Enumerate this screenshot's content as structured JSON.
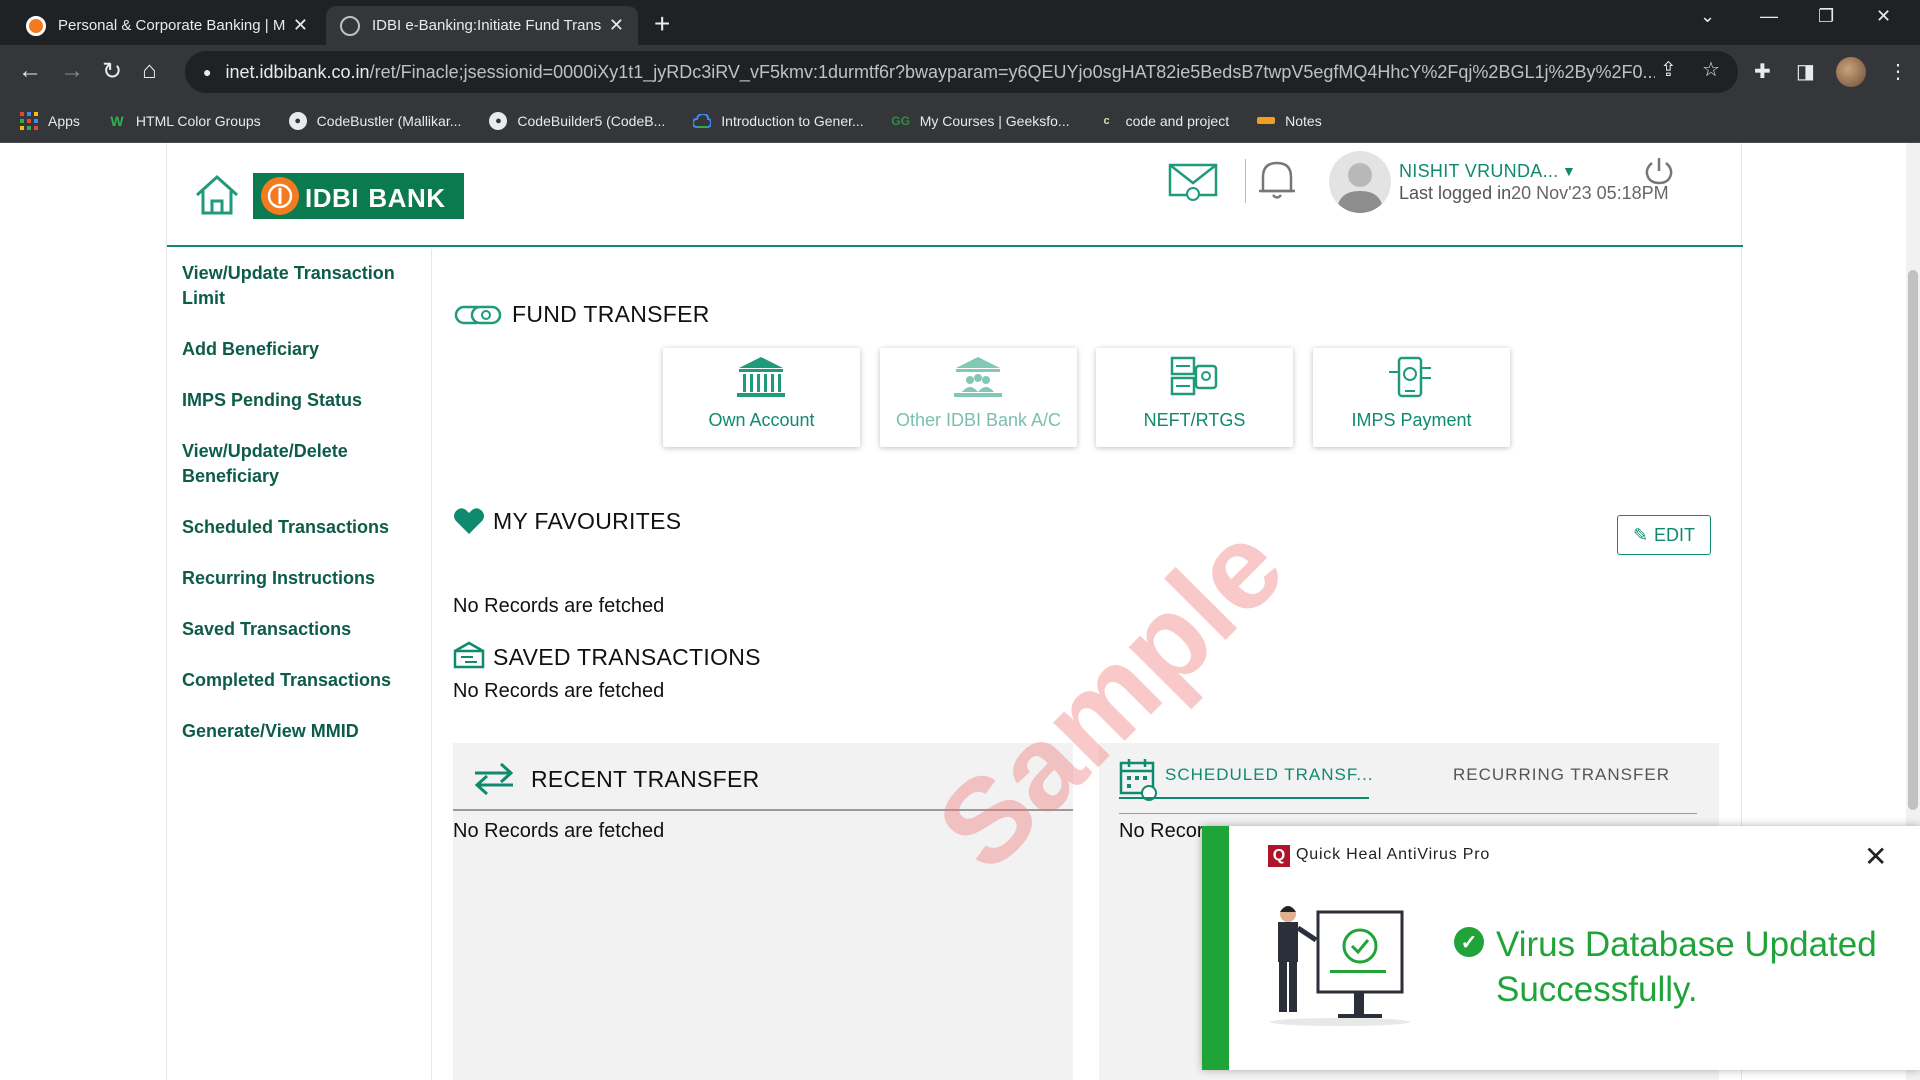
{
  "browser": {
    "tabs": [
      {
        "title": "Personal & Corporate Banking | MS",
        "active": false
      },
      {
        "title": "IDBI e-Banking:Initiate Fund Transfe",
        "active": true
      }
    ],
    "url_host": "inet.idbibank.co.in",
    "url_path": "/ret/Finacle;jsessionid=0000iXy1t1_jyRDc3iRV_vF5kmv:1durmtf6r?bwayparam=y6QEUYjo0sgHAT82ie5BedsB7twpV5egfMQ4HhcY%2Fqj%2BGL1j%2By%2F0...",
    "bookmarks": [
      {
        "label": "Apps",
        "icon": "apps-grid-icon"
      },
      {
        "label": "HTML Color Groups",
        "icon": "w-icon"
      },
      {
        "label": "CodeBustler (Mallikar...",
        "icon": "github-icon"
      },
      {
        "label": "CodeBuilder5 (CodeB...",
        "icon": "github-icon"
      },
      {
        "label": "Introduction to Gener...",
        "icon": "google-cloud-icon"
      },
      {
        "label": "My Courses | Geeksfo...",
        "icon": "geeksforgeeks-icon"
      },
      {
        "label": "code and project",
        "icon": "c-icon"
      },
      {
        "label": "Notes",
        "icon": "notes-icon"
      }
    ]
  },
  "header": {
    "logo_main": "IDBI",
    "logo_sub": "BANK",
    "user_name": "NISHIT VRUNDA...",
    "last_logged_label": "Last logged in",
    "last_logged_value": "20 Nov'23 05:18PM"
  },
  "sidebar": {
    "items": [
      "View/Update Transaction Limit",
      "Add Beneficiary",
      "IMPS Pending Status",
      "View/Update/Delete Beneficiary",
      "Scheduled Transactions",
      "Recurring Instructions",
      "Saved Transactions",
      "Completed Transactions",
      "Generate/View MMID"
    ]
  },
  "fund_transfer": {
    "title": "FUND TRANSFER",
    "options": [
      "Own Account",
      "Other IDBI Bank A/C",
      "NEFT/RTGS",
      "IMPS Payment"
    ]
  },
  "favourites": {
    "title": "MY FAVOURITES",
    "edit_label": "EDIT",
    "empty_text": "No Records are fetched"
  },
  "saved": {
    "title": "SAVED TRANSACTIONS",
    "empty_text": "No Records are fetched"
  },
  "recent": {
    "title": "RECENT TRANSFER",
    "empty_text": "No Records are fetched"
  },
  "scheduled_panel": {
    "tab1": "SCHEDULED TRANSF...",
    "tab2": "RECURRING TRANSFER",
    "empty_text_partial": "No Recor"
  },
  "watermark": "Sample",
  "toast": {
    "app_name": "Quick Heal AntiVirus Pro",
    "logo_letter": "Q",
    "message": "Virus Database Updated Successfully."
  },
  "colors": {
    "brand_green": "#0f8a6e",
    "logo_green": "#0b7a4f",
    "logo_orange": "#f47a20",
    "toast_green": "#20a43a"
  }
}
